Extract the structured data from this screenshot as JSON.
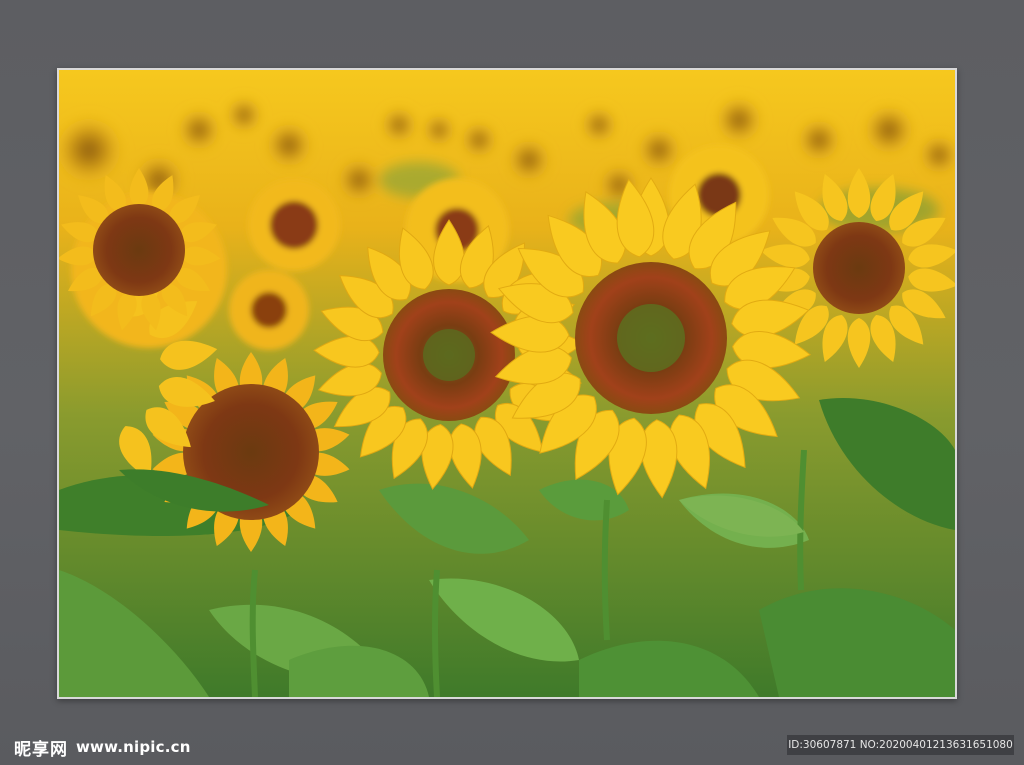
{
  "watermark": {
    "brand": "昵享网",
    "site": "www.nipic.cn"
  },
  "image_info": {
    "id_text": "ID:30607871 NO:20200401213631651080"
  },
  "colors": {
    "background": "#5e5f63",
    "frame": "#d9d9d9",
    "sky": "#f3c11b",
    "petal": "#f7c21c",
    "center": "#7a3a12",
    "leaf": "#4f8a2f"
  },
  "icons": {
    "photo": "sunflower-field-photo"
  }
}
